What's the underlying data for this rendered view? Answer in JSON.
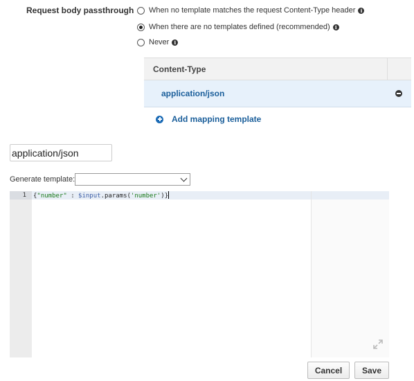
{
  "passthrough": {
    "label": "Request body passthrough",
    "options": [
      {
        "label": "When no template matches the request Content-Type header",
        "checked": false
      },
      {
        "label": "When there are no templates defined (recommended)",
        "checked": true
      },
      {
        "label": "Never",
        "checked": false
      }
    ]
  },
  "content_type_table": {
    "header": "Content-Type",
    "rows": [
      {
        "value": "application/json"
      }
    ],
    "add_label": "Add mapping template"
  },
  "content_type_input": {
    "value": "application/json"
  },
  "generate_template": {
    "label": "Generate template:",
    "selected": ""
  },
  "editor": {
    "line_numbers": [
      "1"
    ],
    "code": {
      "open_brace": "{",
      "key": "\"number\"",
      "sep": " : ",
      "var": "$input",
      "method": ".params(",
      "arg": "'number'",
      "close": ")}"
    }
  },
  "buttons": {
    "cancel": "Cancel",
    "save": "Save"
  },
  "icons": {
    "info": "info-icon",
    "remove": "remove-circle-icon",
    "add": "add-circle-icon",
    "chevron": "chevron-down-icon",
    "expand": "expand-icon"
  },
  "colors": {
    "link": "#1a5e9a",
    "selected_row": "#e7f1fb",
    "add_icon": "#1a6ab5"
  }
}
